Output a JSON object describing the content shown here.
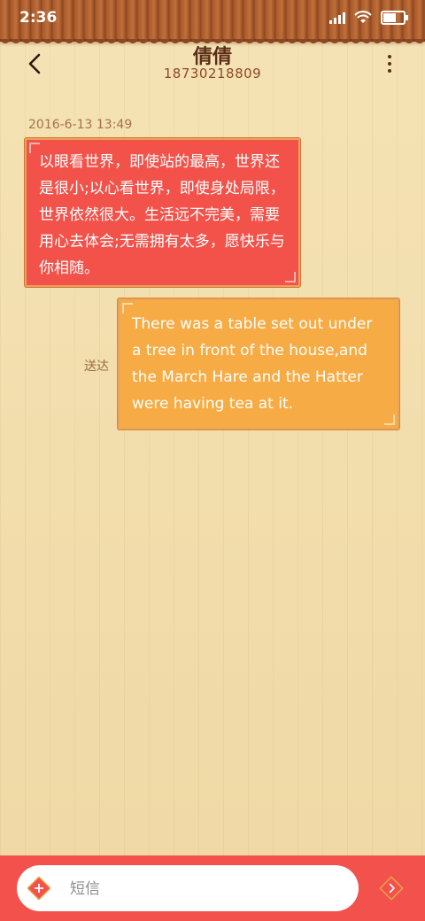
{
  "status_bar": {
    "time": "2:36"
  },
  "header": {
    "contact_name": "倩倩",
    "contact_number": "18730218809"
  },
  "conversation": {
    "timestamp": "2016-6-13 13:49",
    "messages": [
      {
        "direction": "incoming",
        "text": "以眼看世界，即使站的最高，世界还是很小;以心看世界，即使身处局限，世界依然很大。生活远不完美，需要用心去体会;无需拥有太多，愿快乐与你相随。"
      },
      {
        "direction": "outgoing",
        "text": "There was a table set out under a tree in front of the house,and the March Hare and the Hatter were having tea at it.",
        "status": "送达"
      }
    ]
  },
  "composer": {
    "placeholder": "短信"
  },
  "colors": {
    "incoming_bubble": "#f2524a",
    "outgoing_bubble": "#f7ab45",
    "composer_bar": "#f2514c"
  },
  "icons": {
    "back": "chevron-left-icon",
    "menu": "more-vertical-icon",
    "add": "add-attachment-icon",
    "send": "send-icon"
  }
}
